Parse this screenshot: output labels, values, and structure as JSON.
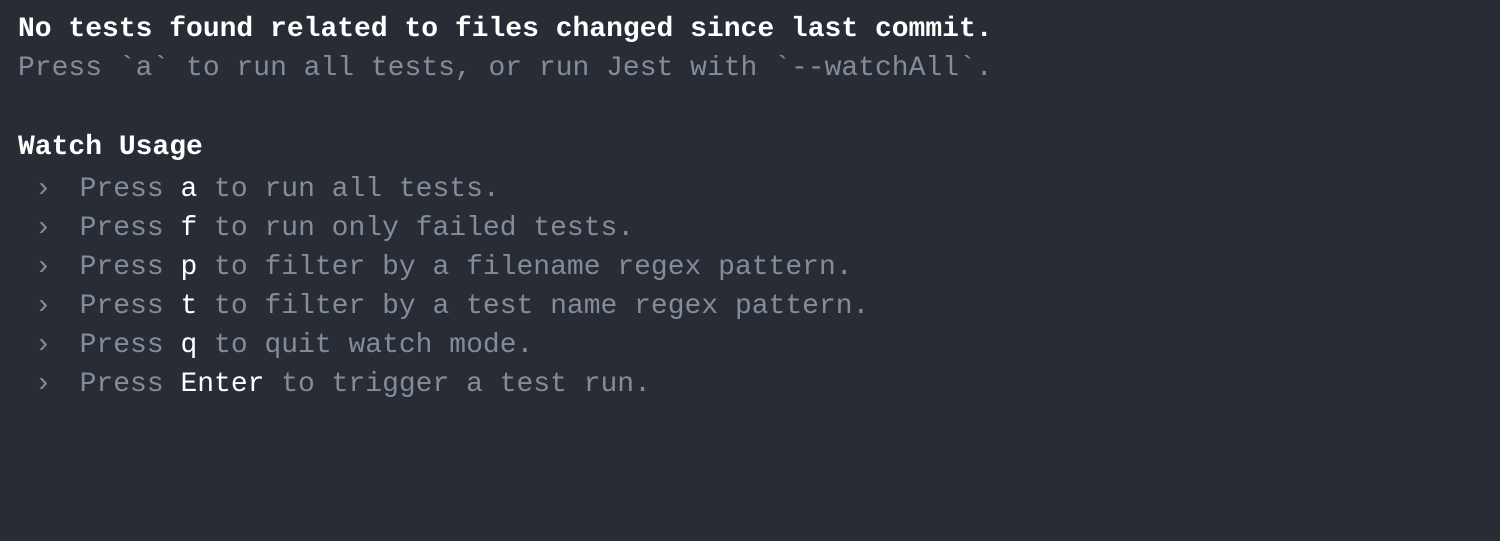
{
  "header": {
    "main_message": "No tests found related to files changed since last commit.",
    "hint_prefix": "Press ",
    "hint_key": "`a`",
    "hint_mid": " to run all tests, or run Jest with ",
    "hint_flag": "`--watchAll`",
    "hint_suffix": "."
  },
  "watch_usage": {
    "heading": "Watch Usage",
    "items": [
      {
        "arrow": "›",
        "before": "Press ",
        "key": "a",
        "after": " to run all tests."
      },
      {
        "arrow": "›",
        "before": "Press ",
        "key": "f",
        "after": " to run only failed tests."
      },
      {
        "arrow": "›",
        "before": "Press ",
        "key": "p",
        "after": " to filter by a filename regex pattern."
      },
      {
        "arrow": "›",
        "before": "Press ",
        "key": "t",
        "after": " to filter by a test name regex pattern."
      },
      {
        "arrow": "›",
        "before": "Press ",
        "key": "q",
        "after": " to quit watch mode."
      },
      {
        "arrow": "›",
        "before": "Press ",
        "key": "Enter",
        "after": " to trigger a test run."
      }
    ]
  }
}
